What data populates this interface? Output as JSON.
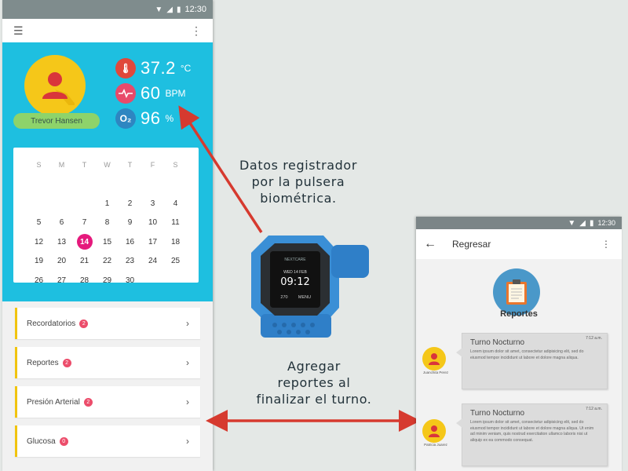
{
  "left_phone": {
    "status_time": "12:30",
    "patient_name": "Trevor Hansen",
    "vitals": [
      {
        "icon": "thermometer-icon",
        "value": "37.2",
        "unit": "°C",
        "color": "#e0483b"
      },
      {
        "icon": "heart-rate-icon",
        "value": "60",
        "unit": "BPM",
        "color": "#e84a6a"
      },
      {
        "icon": "oxygen-icon",
        "value": "96",
        "unit": "%",
        "color": "#2e86c1"
      }
    ],
    "calendar": {
      "weekdays": [
        "S",
        "M",
        "T",
        "W",
        "T",
        "F",
        "S"
      ],
      "days": [
        "",
        "",
        "",
        "",
        "",
        "",
        "",
        "",
        "",
        "",
        "1",
        "2",
        "3",
        "4",
        "5",
        "6",
        "7",
        "8",
        "9",
        "10",
        "11",
        "12",
        "13",
        "14",
        "15",
        "16",
        "17",
        "18",
        "19",
        "20",
        "21",
        "22",
        "23",
        "24",
        "25",
        "26",
        "27",
        "28",
        "29",
        "30",
        "",
        ""
      ],
      "today": "14"
    },
    "menu": [
      {
        "label": "Recordatorios",
        "badge": "2"
      },
      {
        "label": "Reportes",
        "badge": "2"
      },
      {
        "label": "Presión Arterial",
        "badge": "2"
      },
      {
        "label": "Glucosa",
        "badge": "0"
      }
    ]
  },
  "captions": {
    "top": [
      "Datos registrador",
      "por la pulsera",
      "biométrica."
    ],
    "bottom": [
      "Agregar",
      "reportes al",
      "finalizar el turno."
    ]
  },
  "watch": {
    "brand": "NEXTCARE",
    "date": "WED 14 FEB",
    "time": "09:12",
    "steps": "270",
    "menu_label": "MENU"
  },
  "right_phone": {
    "status_time": "12:30",
    "back_label": "Regresar",
    "section_title": "Reportes",
    "reports": [
      {
        "title": "Turno Nocturno",
        "time": "7:12 a.m.",
        "author": "Juanchita Perez",
        "body": "Lorem ipsum dolor sit amet, consectetur adipisicing elit, sed do eiusmod tempor incididunt ut labore et dolore magna aliqua."
      },
      {
        "title": "Turno Nocturno",
        "time": "7:12 a.m.",
        "author": "Patricia Juarez",
        "body": "Lorem ipsum dolor sit amet, consectetur adipisicing elit, sed do eiusmod tempor incididunt ut labore et dolore magna aliqua. Ut enim ad minim veniam, quis nostrud exercitation ullamco laboris nisi ut aliquip ex ea commodo consequat."
      }
    ]
  },
  "colors": {
    "hero": "#1ebfe0",
    "accent": "#f1c40f",
    "arrow": "#d63a2f",
    "today": "#e5197c"
  }
}
